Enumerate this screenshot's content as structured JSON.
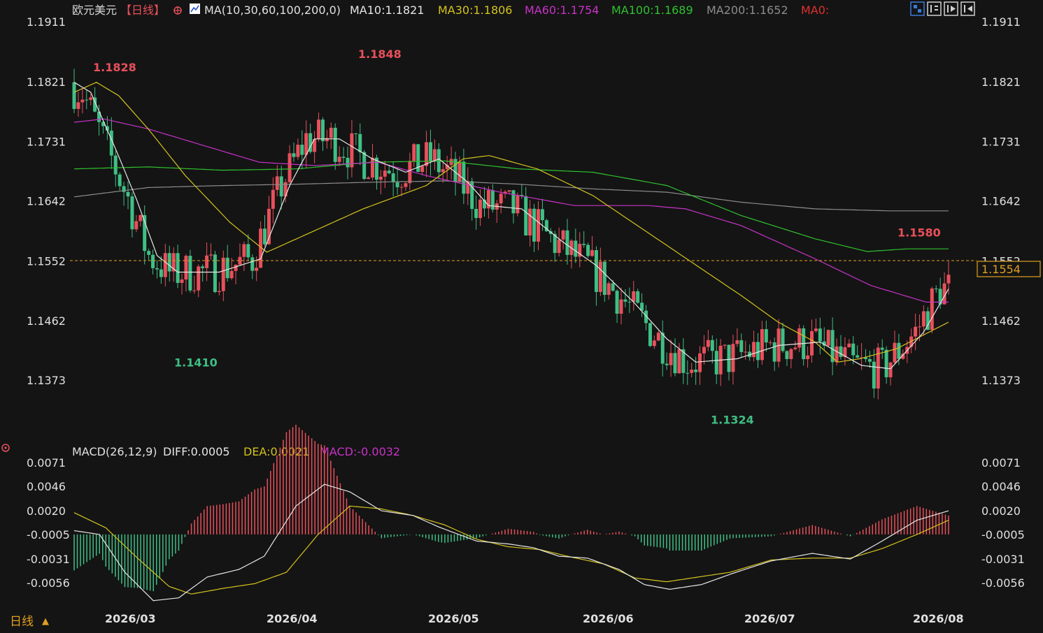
{
  "header": {
    "symbol": "欧元美元",
    "period_tag": "【日线】",
    "ma_label": "MA(10,30,60,100,200,0)",
    "ma10": "MA10:1.1821",
    "ma30": "MA30:1.1806",
    "ma60": "MA60:1.1754",
    "ma100": "MA100:1.1689",
    "ma200": "MA200:1.1652",
    "ma0": "MA0:"
  },
  "macd_header": {
    "label": "MACD(26,12,9)",
    "diff": "DIFF:0.0005",
    "dea": "DEA:0.0021",
    "macd": "MACD:-0.0032"
  },
  "footer": {
    "period_button": "日线",
    "arrow": "▲"
  },
  "colors": {
    "background": "#141414",
    "up": "#e8505b",
    "down": "#3fbf85",
    "ma10": "#e6e6e6",
    "ma30": "#d4c21e",
    "ma60": "#c832c8",
    "ma100": "#2fc12f",
    "ma200": "#8c8c8c",
    "current_price": "#e0a020",
    "label_high": "#e8505b",
    "label_low": "#3fbf85"
  },
  "chart_data": [
    {
      "type": "candlestick",
      "title": "欧元美元【日线】",
      "y_ticks": [
        "1.1911",
        "1.1821",
        "1.1731",
        "1.1642",
        "1.1552",
        "1.1462",
        "1.1373"
      ],
      "ylim": [
        1.13,
        1.193
      ],
      "x_ticks": [
        "2026/03",
        "2026/04",
        "2026/05",
        "2026/06",
        "2026/07",
        "2026/08"
      ],
      "current_price": "1.1554",
      "annotations": [
        {
          "text": "1.1828",
          "kind": "high",
          "value": 1.1828
        },
        {
          "text": "1.1848",
          "kind": "high",
          "value": 1.1848
        },
        {
          "text": "1.1410",
          "kind": "low",
          "value": 1.141
        },
        {
          "text": "1.1324",
          "kind": "low",
          "value": 1.1324
        },
        {
          "text": "1.1580",
          "kind": "high",
          "value": 1.158
        }
      ],
      "ma_series_keyframes": {
        "ma10": [
          [
            0,
            1.182
          ],
          [
            4,
            1.1805
          ],
          [
            10,
            1.172
          ],
          [
            15,
            1.1645
          ],
          [
            20,
            1.156
          ],
          [
            25,
            1.1535
          ],
          [
            35,
            1.1535
          ],
          [
            45,
            1.1555
          ],
          [
            52,
            1.1665
          ],
          [
            58,
            1.1735
          ],
          [
            64,
            1.1735
          ],
          [
            72,
            1.1705
          ],
          [
            80,
            1.1685
          ],
          [
            88,
            1.1705
          ],
          [
            95,
            1.167
          ],
          [
            100,
            1.1635
          ],
          [
            108,
            1.163
          ],
          [
            118,
            1.158
          ],
          [
            126,
            1.1545
          ],
          [
            135,
            1.149
          ],
          [
            143,
            1.1435
          ],
          [
            150,
            1.14
          ],
          [
            160,
            1.1405
          ],
          [
            170,
            1.1425
          ],
          [
            180,
            1.143
          ],
          [
            190,
            1.1395
          ],
          [
            197,
            1.139
          ],
          [
            205,
            1.1445
          ],
          [
            211,
            1.151
          ]
        ],
        "ma30": [
          [
            0,
            1.1805
          ],
          [
            6,
            1.182
          ],
          [
            12,
            1.18
          ],
          [
            20,
            1.175
          ],
          [
            30,
            1.168
          ],
          [
            42,
            1.161
          ],
          [
            52,
            1.1565
          ],
          [
            62,
            1.159
          ],
          [
            78,
            1.163
          ],
          [
            95,
            1.1665
          ],
          [
            105,
            1.1705
          ],
          [
            112,
            1.171
          ],
          [
            125,
            1.169
          ],
          [
            140,
            1.165
          ],
          [
            160,
            1.1575
          ],
          [
            180,
            1.15
          ],
          [
            190,
            1.146
          ],
          [
            200,
            1.143
          ],
          [
            206,
            1.14
          ],
          [
            212,
            1.1405
          ],
          [
            222,
            1.142
          ],
          [
            236,
            1.146
          ]
        ],
        "ma60": [
          [
            0,
            1.176
          ],
          [
            8,
            1.1765
          ],
          [
            20,
            1.175
          ],
          [
            35,
            1.1725
          ],
          [
            50,
            1.17
          ],
          [
            65,
            1.1695
          ],
          [
            82,
            1.17
          ],
          [
            95,
            1.168
          ],
          [
            115,
            1.1655
          ],
          [
            135,
            1.1635
          ],
          [
            155,
            1.1635
          ],
          [
            165,
            1.163
          ],
          [
            180,
            1.1605
          ],
          [
            200,
            1.1555
          ],
          [
            215,
            1.1515
          ],
          [
            230,
            1.149
          ],
          [
            236,
            1.149
          ]
        ],
        "ma100": [
          [
            0,
            1.169
          ],
          [
            20,
            1.1693
          ],
          [
            40,
            1.1688
          ],
          [
            60,
            1.169
          ],
          [
            80,
            1.17
          ],
          [
            100,
            1.1702
          ],
          [
            120,
            1.169
          ],
          [
            140,
            1.1685
          ],
          [
            160,
            1.1665
          ],
          [
            180,
            1.162
          ],
          [
            200,
            1.1585
          ],
          [
            214,
            1.1566
          ],
          [
            225,
            1.157
          ],
          [
            236,
            1.157
          ]
        ],
        "ma200": [
          [
            0,
            1.1648
          ],
          [
            20,
            1.1662
          ],
          [
            40,
            1.1665
          ],
          [
            60,
            1.1667
          ],
          [
            80,
            1.167
          ],
          [
            100,
            1.1672
          ],
          [
            120,
            1.1667
          ],
          [
            140,
            1.166
          ],
          [
            160,
            1.1655
          ],
          [
            180,
            1.164
          ],
          [
            200,
            1.163
          ],
          [
            220,
            1.1627
          ],
          [
            236,
            1.1627
          ]
        ]
      }
    },
    {
      "type": "bar+line",
      "title": "MACD(26,12,9)",
      "y_ticks": [
        "0.0071",
        "0.0046",
        "0.0020",
        "-0.0005",
        "-0.0031",
        "-0.0056"
      ],
      "ylim": [
        -0.0083,
        0.0071
      ],
      "series_keyframes": {
        "diff": [
          [
            0,
            -0.0001
          ],
          [
            8,
            -0.0005
          ],
          [
            16,
            -0.0045
          ],
          [
            25,
            -0.0075
          ],
          [
            33,
            -0.0072
          ],
          [
            42,
            -0.005
          ],
          [
            52,
            -0.0042
          ],
          [
            60,
            -0.0028
          ],
          [
            70,
            0.0025
          ],
          [
            79,
            0.0048
          ],
          [
            87,
            0.004
          ],
          [
            97,
            0.002
          ],
          [
            107,
            0.0015
          ],
          [
            115,
            0.0003
          ],
          [
            127,
            -0.0012
          ],
          [
            137,
            -0.0015
          ],
          [
            145,
            -0.0019
          ],
          [
            153,
            -0.0028
          ],
          [
            162,
            -0.003
          ],
          [
            172,
            -0.0042
          ],
          [
            180,
            -0.0058
          ],
          [
            188,
            -0.0063
          ],
          [
            198,
            -0.0058
          ],
          [
            208,
            -0.0046
          ],
          [
            220,
            -0.0033
          ],
          [
            233,
            -0.0025
          ],
          [
            245,
            -0.0031
          ],
          [
            255,
            -0.0012
          ],
          [
            266,
            0.001
          ],
          [
            276,
            0.002
          ]
        ],
        "dea": [
          [
            0,
            0.0018
          ],
          [
            10,
            0.0002
          ],
          [
            20,
            -0.003
          ],
          [
            30,
            -0.006
          ],
          [
            37,
            -0.0068
          ],
          [
            47,
            -0.0062
          ],
          [
            57,
            -0.0057
          ],
          [
            67,
            -0.0045
          ],
          [
            77,
            -0.0005
          ],
          [
            87,
            0.0025
          ],
          [
            97,
            0.0022
          ],
          [
            107,
            0.0015
          ],
          [
            117,
            0.0005
          ],
          [
            127,
            -0.001
          ],
          [
            137,
            -0.0018
          ],
          [
            147,
            -0.0021
          ],
          [
            157,
            -0.0029
          ],
          [
            167,
            -0.0036
          ],
          [
            177,
            -0.0051
          ],
          [
            187,
            -0.0055
          ],
          [
            197,
            -0.005
          ],
          [
            207,
            -0.0045
          ],
          [
            220,
            -0.0032
          ],
          [
            233,
            -0.003
          ],
          [
            245,
            -0.003
          ],
          [
            255,
            -0.002
          ],
          [
            266,
            -0.0005
          ],
          [
            276,
            0.001
          ]
        ]
      }
    }
  ]
}
